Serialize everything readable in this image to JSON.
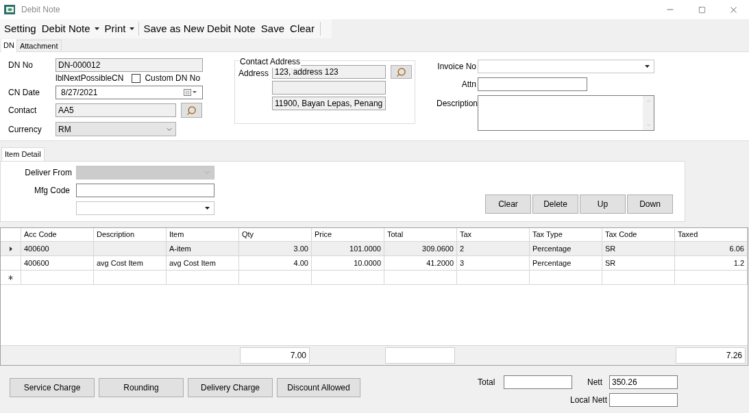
{
  "window": {
    "title": "Debit Note"
  },
  "menu": [
    {
      "label": "Setting",
      "dropdown": false
    },
    {
      "label": "Debit Note",
      "dropdown": true
    },
    {
      "label": "Print",
      "dropdown": true
    },
    {
      "label": "Save as New Debit Note",
      "dropdown": false
    },
    {
      "label": "Save",
      "dropdown": false
    },
    {
      "label": "Clear",
      "dropdown": false
    }
  ],
  "tabs": [
    {
      "label": "DN",
      "selected": true
    },
    {
      "label": "Attachment",
      "selected": false
    }
  ],
  "header": {
    "dn_no": {
      "label": "DN No",
      "value": "DN-000012"
    },
    "next_cn_label": "lblNextPossibleCN",
    "custom_dn": {
      "label": "Custom DN No",
      "checked": false
    },
    "cn_date": {
      "label": "CN Date",
      "value": "8/27/2021"
    },
    "contact": {
      "label": "Contact",
      "value": "AA5"
    },
    "currency": {
      "label": "Currency",
      "value": "RM"
    },
    "contact_address": {
      "title": "Contact Address",
      "label": "Address",
      "line_1": "123, address 123",
      "line_3": "11900, Bayan Lepas, Penang"
    },
    "invoice_no": {
      "label": "Invoice No"
    },
    "attn": {
      "label": "Attn"
    },
    "description": {
      "label": "Description"
    }
  },
  "item_detail": {
    "tab": {
      "label": "Item Detail",
      "selected": true
    },
    "deliver_from": {
      "label": "Deliver From",
      "disabled": true
    },
    "mfg_code": {
      "label": "Mfg Code"
    },
    "buttons": [
      "Clear",
      "Delete",
      "Up",
      "Down"
    ]
  },
  "grid": {
    "columns": [
      "Acc Code",
      "Description",
      "Item",
      "Qty",
      "Price",
      "Total",
      "Tax",
      "Tax Type",
      "Tax Code",
      "Taxed"
    ],
    "rows": [
      {
        "selected": true,
        "acc_code": "400600",
        "item": "A-item",
        "qty": "3.00",
        "price": "101.0000",
        "total": "309.0600",
        "tax": "2",
        "tax_type": "Percentage",
        "tax_code": "SR",
        "taxed": "6.06"
      },
      {
        "selected": false,
        "acc_code": "400600",
        "description": "avg Cost Item",
        "item": "avg Cost Item",
        "qty": "4.00",
        "price": "10.0000",
        "total": "41.2000",
        "tax": "3",
        "tax_type": "Percentage",
        "tax_code": "SR",
        "taxed": "1.2"
      }
    ],
    "totals": {
      "qty": "7.00",
      "taxed": "7.26"
    }
  },
  "buttons": [
    "Service Charge",
    "Rounding",
    "Delivery Charge",
    "Discount Allowed"
  ],
  "summary": {
    "total": {
      "label": "Total"
    },
    "nett": {
      "label": "Nett",
      "value": "350.26"
    },
    "local_nett": {
      "label": "Local Nett"
    }
  }
}
